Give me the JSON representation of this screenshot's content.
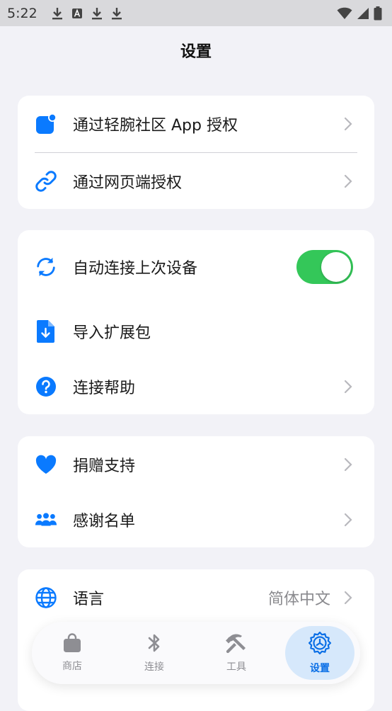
{
  "status_bar": {
    "time": "5:22"
  },
  "page": {
    "title": "设置"
  },
  "auth_section": {
    "app_auth_label": "通过轻腕社区 App 授权",
    "web_auth_label": "通过网页端授权"
  },
  "connect_section": {
    "auto_connect_label": "自动连接上次设备",
    "auto_connect_on": true,
    "import_label": "导入扩展包",
    "help_label": "连接帮助"
  },
  "support_section": {
    "donate_label": "捐赠支持",
    "thanks_label": "感谢名单"
  },
  "language_section": {
    "language_label": "语言",
    "language_value": "简体中文"
  },
  "tabs": [
    {
      "label": "商店",
      "icon": "bag-icon"
    },
    {
      "label": "连接",
      "icon": "bluetooth-icon"
    },
    {
      "label": "工具",
      "icon": "hammer-icon"
    },
    {
      "label": "设置",
      "icon": "gear-icon",
      "active": true
    }
  ],
  "colors": {
    "accent": "#0a7aff",
    "toggle_on": "#34c759",
    "background": "#f2f2f7"
  }
}
